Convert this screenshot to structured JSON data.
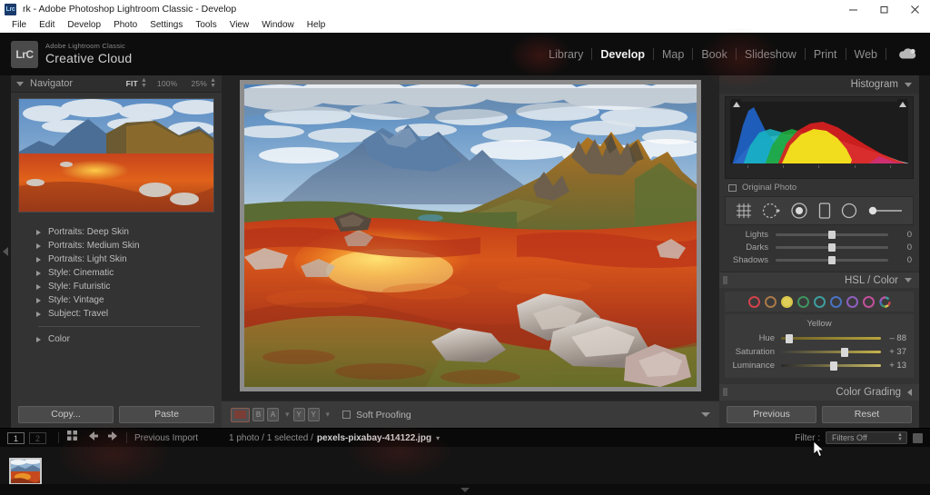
{
  "window": {
    "title": "rk - Adobe Photoshop Lightroom Classic - Develop",
    "app_badge": "Lrc",
    "minimize": "─",
    "maximize": "❐",
    "close": "✕"
  },
  "menubar": {
    "items": [
      "File",
      "Edit",
      "Develop",
      "Photo",
      "Settings",
      "Tools",
      "View",
      "Window",
      "Help"
    ]
  },
  "identity": {
    "badge": "LrC",
    "line1": "Adobe Lightroom Classic",
    "line2": "Creative Cloud"
  },
  "modules": {
    "items": [
      {
        "label": "Library",
        "active": false
      },
      {
        "label": "Develop",
        "active": true
      },
      {
        "label": "Map",
        "active": false
      },
      {
        "label": "Book",
        "active": false
      },
      {
        "label": "Slideshow",
        "active": false
      },
      {
        "label": "Print",
        "active": false
      },
      {
        "label": "Web",
        "active": false
      }
    ],
    "cloud_icon": "cloud-sync-icon"
  },
  "navigator": {
    "title": "Navigator",
    "zoom_fit": "FIT",
    "zoom_100": "100%",
    "zoom_25": "25%",
    "disclosure_icon": "triangle-down-icon"
  },
  "presets": {
    "items": [
      "Portraits: Deep Skin",
      "Portraits: Medium Skin",
      "Portraits: Light Skin",
      "Style: Cinematic",
      "Style: Futuristic",
      "Style: Vintage",
      "Subject: Travel"
    ],
    "after_divider": [
      "Color"
    ]
  },
  "left_footer": {
    "copy": "Copy...",
    "paste": "Paste"
  },
  "center_toolbar": {
    "loupe_view_icon": "loupe-view-icon",
    "before_after_icon": "before-after-icon",
    "yy_icon": "before-after-yy-icon",
    "soft_proofing": "Soft Proofing",
    "caret_icon": "triangle-down-icon"
  },
  "histogram": {
    "title": "Histogram",
    "original_photo": "Original Photo",
    "shadow_clip_icon": "shadow-clipping-icon",
    "highlight_clip_icon": "highlight-clipping-icon"
  },
  "toolstrip": {
    "items": [
      {
        "name": "crop-overlay-icon"
      },
      {
        "name": "spot-removal-icon"
      },
      {
        "name": "red-eye-icon"
      },
      {
        "name": "linear-gradient-mask-icon"
      },
      {
        "name": "radial-gradient-mask-icon"
      },
      {
        "name": "adjustment-brush-icon"
      }
    ]
  },
  "basic_sliders": [
    {
      "label": "Lights",
      "value": "0",
      "pos": 50
    },
    {
      "label": "Darks",
      "value": "0",
      "pos": 50
    },
    {
      "label": "Shadows",
      "value": "0",
      "pos": 50
    }
  ],
  "hsl": {
    "title": "HSL / Color",
    "swatches": [
      {
        "name": "red",
        "color": "#d0434b"
      },
      {
        "name": "orange",
        "color": "#a97849"
      },
      {
        "name": "yellow",
        "color": "#d8c64a",
        "selected": true
      },
      {
        "name": "green",
        "color": "#3f9460"
      },
      {
        "name": "aqua",
        "color": "#3e9e9e"
      },
      {
        "name": "blue",
        "color": "#4a72c0"
      },
      {
        "name": "purple",
        "color": "#8f5fbe"
      },
      {
        "name": "magenta",
        "color": "#c2509b"
      },
      {
        "name": "all",
        "color": "#b8a050"
      }
    ],
    "channel": "Yellow",
    "sliders": [
      {
        "label": "Hue",
        "value": "– 88",
        "pos": 8
      },
      {
        "label": "Saturation",
        "value": "+ 37",
        "pos": 64
      },
      {
        "label": "Luminance",
        "value": "+ 13",
        "pos": 53
      }
    ]
  },
  "color_grading": {
    "title": "Color Grading",
    "caret_icon": "triangle-left-icon"
  },
  "right_footer": {
    "previous": "Previous",
    "reset": "Reset"
  },
  "filmstrip_bar": {
    "page_1": "1",
    "page_2": "2",
    "grid_icon": "grid-view-icon",
    "back_icon": "arrow-left-icon",
    "forward_icon": "arrow-right-icon",
    "source": "Previous Import",
    "count": "1 photo / 1 selected /",
    "filename": "pexels-pixabay-414122.jpg",
    "filename_caret": "triangle-down-icon",
    "filter_label": "Filter :",
    "filter_value": "Filters Off",
    "lock_icon": "filter-lock-icon"
  },
  "filmstrip": {
    "thumbnails": [
      {
        "name": "thumbnail-1"
      }
    ]
  },
  "photo": {
    "name": "dolomites-autumn-landscape",
    "alt": "Autumn alpine meadow with red and orange vegetation, rocky outcrops, and blue mountain peaks under cloudy sky"
  },
  "colors": {
    "panel_bg": "#333333",
    "work_bg": "#1a1a1a",
    "accent_text": "#f0f0f0"
  }
}
